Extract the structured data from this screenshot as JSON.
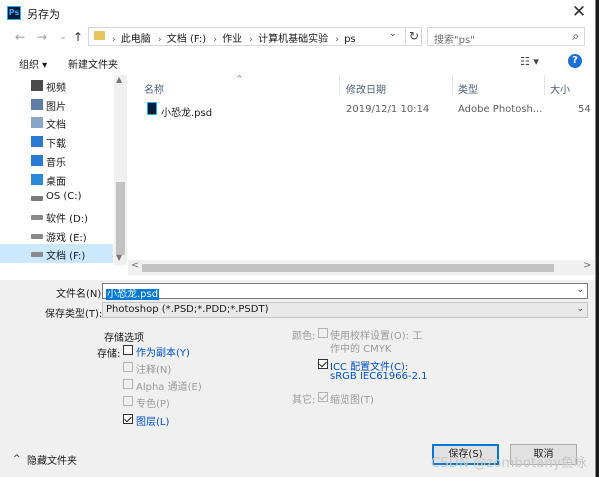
{
  "window": {
    "title": "另存为",
    "app_icon": "Ps",
    "close_glyph": "✕"
  },
  "nav": {
    "back_glyph": "←",
    "forward_glyph": "→",
    "recent_glyph": "⌄",
    "up_glyph": "↑",
    "breadcrumbs": [
      "此电脑",
      "文档 (F:)",
      "作业",
      "计算机基础实验",
      "ps"
    ],
    "separator": "›",
    "refresh_glyph": "↻",
    "dropdown_glyph": "⌄",
    "search_placeholder": "搜索\"ps\"",
    "search_glyph": "⌕"
  },
  "toolbar": {
    "organize_label": "组织 ▾",
    "new_folder_label": "新建文件夹",
    "view_glyph": "☷ ▾",
    "help_glyph": "?"
  },
  "sidebar": {
    "items": [
      {
        "label": "视频",
        "icon": "video-icon"
      },
      {
        "label": "图片",
        "icon": "pictures-icon"
      },
      {
        "label": "文档",
        "icon": "documents-icon"
      },
      {
        "label": "下载",
        "icon": "download-icon"
      },
      {
        "label": "音乐",
        "icon": "music-icon"
      },
      {
        "label": "桌面",
        "icon": "desktop-icon"
      },
      {
        "label": "OS (C:)",
        "icon": "os-drive-icon"
      },
      {
        "label": "软件 (D:)",
        "icon": "drive-icon"
      },
      {
        "label": "游戏 (E:)",
        "icon": "drive-icon"
      },
      {
        "label": "文档 (F:)",
        "icon": "drive-icon"
      }
    ],
    "selected_index": 9
  },
  "file_list": {
    "columns": [
      "名称",
      "修改日期",
      "类型",
      "大小"
    ],
    "sort_glyph": "^",
    "rows": [
      {
        "name": "小恐龙.psd",
        "modified": "2019/12/1 10:14",
        "type": "Adobe Photosh...",
        "size": "54"
      }
    ]
  },
  "scroll": {
    "up": "▲",
    "down": "▼",
    "left": "<",
    "right": ">"
  },
  "form": {
    "filename_label": "文件名(N):",
    "filename_value": "小恐龙.psd",
    "type_label": "保存类型(T):",
    "type_value": "Photoshop (*.PSD;*.PDD;*.PSDT)",
    "dropdown_glyph": "⌄",
    "save_options_title": "存储选项",
    "save_label": "存储:",
    "options": [
      {
        "label": "作为副本(Y)",
        "checked": false,
        "enabled": true
      },
      {
        "label": "注释(N)",
        "checked": false,
        "enabled": false
      },
      {
        "label": "Alpha 通道(E)",
        "checked": false,
        "enabled": false
      },
      {
        "label": "专色(P)",
        "checked": false,
        "enabled": false
      },
      {
        "label": "图层(L)",
        "checked": true,
        "enabled": true
      }
    ],
    "color_label": "颜色:",
    "proof_line1": "使用校样设置(O): 工",
    "proof_line2": "作中的 CMYK",
    "icc_line1": "ICC 配置文件(C):",
    "icc_line2": "sRGB IEC61966-2.1",
    "icc_checked": true,
    "other_label": "其它:",
    "thumb_label": "缩览图(T)",
    "thumb_checked": true
  },
  "footer": {
    "hide_folders_label": "隐藏文件夹",
    "hide_glyph": "^",
    "save_button": "保存(S)",
    "cancel_button": "取消"
  },
  "watermark": "CSDN @zombotany鱼咏"
}
